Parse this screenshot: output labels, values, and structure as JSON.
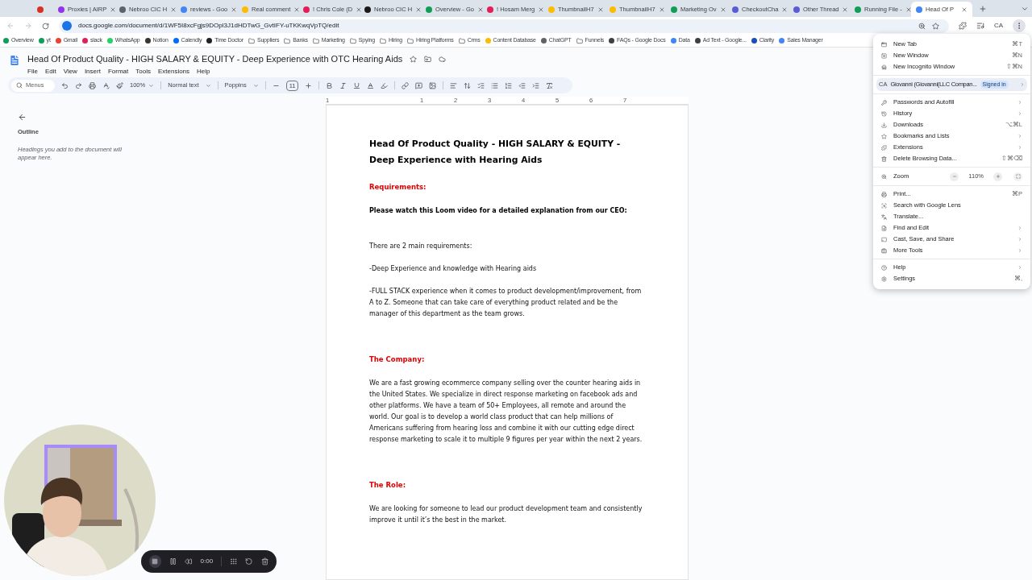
{
  "browser": {
    "tabs": [
      {
        "selected": false,
        "color": "#d93025"
      },
      {
        "title": "Proxies | AIRP",
        "selected": false,
        "color": "#9334e6"
      },
      {
        "title": "Nebroo CIC H",
        "selected": false,
        "color": "#5f6368"
      },
      {
        "title": "reviews - Goo",
        "selected": false,
        "color": "#4285f4"
      },
      {
        "title": "Real comment",
        "selected": false,
        "color": "#fbbc04"
      },
      {
        "title": "! Chris Cole (D",
        "selected": false,
        "color": "#e01e5a"
      },
      {
        "title": "Nebroo CIC H",
        "selected": false,
        "color": "#1a1a1a"
      },
      {
        "title": "Overview - Go",
        "selected": false,
        "color": "#0f9d58"
      },
      {
        "title": "! Hosam Merg",
        "selected": false,
        "color": "#e01e5a"
      },
      {
        "title": "ThumbnailH7",
        "selected": false,
        "color": "#fbbc04"
      },
      {
        "title": "ThumbnailH7",
        "selected": false,
        "color": "#fbbc04"
      },
      {
        "title": "Marketing Ov",
        "selected": false,
        "color": "#0f9d58"
      },
      {
        "title": "CheckoutCha",
        "selected": false,
        "color": "#5b5bd6"
      },
      {
        "title": "Other Thread",
        "selected": false,
        "color": "#5b5bd6"
      },
      {
        "title": "Running File -",
        "selected": false,
        "color": "#0f9d58"
      },
      {
        "title": "Head Of P",
        "selected": true,
        "color": "#4285f4"
      }
    ],
    "address": "docs.google.com/document/d/1WF5I8xcFgjs9DOpl3J1dHDTwG_GvtIFY-uTKKwqVpTQ/edit",
    "profile": "CA",
    "bookmarks": [
      {
        "label": "Overview",
        "kind": "site",
        "color": "#0f9d58"
      },
      {
        "label": "yt",
        "kind": "site",
        "color": "#0f9d58"
      },
      {
        "label": "Gmail",
        "kind": "site",
        "color": "#ea4335"
      },
      {
        "label": "slack",
        "kind": "site",
        "color": "#e01e5a"
      },
      {
        "label": "WhatsApp",
        "kind": "site",
        "color": "#25d366"
      },
      {
        "label": "Notion",
        "kind": "site",
        "color": "#37352f"
      },
      {
        "label": "Calendly",
        "kind": "site",
        "color": "#006bff"
      },
      {
        "label": "Time Doctor",
        "kind": "site",
        "color": "#202124"
      },
      {
        "label": "Suppliers",
        "kind": "folder"
      },
      {
        "label": "Banks",
        "kind": "folder"
      },
      {
        "label": "Marketing",
        "kind": "folder"
      },
      {
        "label": "Spying",
        "kind": "folder"
      },
      {
        "label": "Hiring",
        "kind": "folder"
      },
      {
        "label": "Hiring Platforms",
        "kind": "folder"
      },
      {
        "label": "Crms",
        "kind": "folder"
      },
      {
        "label": "Content Database",
        "kind": "site",
        "color": "#fbbc04"
      },
      {
        "label": "ChatGPT",
        "kind": "site",
        "color": "#5f6368"
      },
      {
        "label": "Funnels",
        "kind": "folder"
      },
      {
        "label": "FAQs - Google Docs",
        "kind": "site",
        "color": "#3c4043"
      },
      {
        "label": "Data",
        "kind": "site",
        "color": "#4285f4"
      },
      {
        "label": "Ad Text - Google...",
        "kind": "site",
        "color": "#3c4043"
      },
      {
        "label": "Clarity",
        "kind": "site",
        "color": "#1a4fb4"
      },
      {
        "label": "Sales Manager",
        "kind": "site",
        "color": "#4285f4"
      }
    ]
  },
  "document": {
    "title": "Head Of Product Quality - HIGH SALARY & EQUITY - Deep Experience with OTC Hearing Aids",
    "menus": [
      "File",
      "Edit",
      "View",
      "Insert",
      "Format",
      "Tools",
      "Extensions",
      "Help"
    ],
    "toolbar": {
      "search_placeholder": "Menus",
      "zoom": "100%",
      "style": "Normal text",
      "font": "Poppins",
      "font_size": "11"
    },
    "ruler": [
      "1",
      "1",
      "2",
      "3",
      "4",
      "5",
      "6",
      "7"
    ],
    "outline": {
      "title": "Outline",
      "hint": "Headings you add to the document will appear here."
    },
    "body": [
      {
        "kind": "title",
        "text": "Head Of Product Quality - HIGH SALARY & EQUITY - Deep Experience with Hearing Aids"
      },
      {
        "kind": "heading",
        "text": "Requirements:"
      },
      {
        "kind": "bold",
        "text": "Please watch this Loom video for a detailed explanation from our CEO:"
      },
      {
        "kind": "para",
        "text": "There are 2 main requirements:"
      },
      {
        "kind": "para",
        "text": "-Deep Experience and knowledge with Hearing aids"
      },
      {
        "kind": "para",
        "text": "-FULL STACK experience when it comes to product development/improvement, from A to Z. Someone that can take care of everything product related and be the manager of this department as the team grows."
      },
      {
        "kind": "heading",
        "text": "The Company:"
      },
      {
        "kind": "para",
        "text": "We are a fast growing ecommerce company selling over the counter hearing aids in the United States. We specialize in direct response marketing on facebook ads and other platforms. We have a team of 50+ Employees, all remote and around the world. Our goal is to develop a world class product that can help millions of Americans suffering from hearing loss and combine it with our cutting edge direct response marketing to scale it to multiple 9 figures per year within the next 2 years."
      },
      {
        "kind": "heading",
        "text": "The Role:"
      },
      {
        "kind": "para",
        "text": "We are looking for someone to lead our product development team and consistently improve it until it’s the best in the market."
      }
    ]
  },
  "chrome_menu": {
    "sections": [
      [
        {
          "kind": "item",
          "label": "New Tab",
          "shortcut": "⌘T"
        },
        {
          "kind": "item",
          "label": "New Window",
          "shortcut": "⌘N"
        },
        {
          "kind": "item",
          "label": "New Incognito Window",
          "shortcut": "⇧⌘N"
        }
      ],
      [
        {
          "kind": "profile",
          "avatar": "CA",
          "label": "Giovanni (Giovanni(LLC Compan...",
          "badge": "Signed in",
          "submenu": true
        }
      ],
      [
        {
          "kind": "item",
          "label": "Passwords and Autofill",
          "submenu": true
        },
        {
          "kind": "item",
          "label": "History",
          "submenu": true
        },
        {
          "kind": "item",
          "label": "Downloads",
          "shortcut": "⌥⌘L"
        },
        {
          "kind": "item",
          "label": "Bookmarks and Lists",
          "submenu": true
        },
        {
          "kind": "item",
          "label": "Extensions",
          "submenu": true
        },
        {
          "kind": "item",
          "label": "Delete Browsing Data...",
          "shortcut": "⇧⌘⌫"
        }
      ],
      [
        {
          "kind": "zoom",
          "label": "Zoom",
          "value": "110%"
        }
      ],
      [
        {
          "kind": "item",
          "label": "Print...",
          "shortcut": "⌘P"
        },
        {
          "kind": "item",
          "label": "Search with Google Lens"
        },
        {
          "kind": "item",
          "label": "Translate..."
        },
        {
          "kind": "item",
          "label": "Find and Edit",
          "submenu": true
        },
        {
          "kind": "item",
          "label": "Cast, Save, and Share",
          "submenu": true
        },
        {
          "kind": "item",
          "label": "More Tools",
          "submenu": true
        }
      ],
      [
        {
          "kind": "item",
          "label": "Help",
          "submenu": true
        },
        {
          "kind": "item",
          "label": "Settings",
          "shortcut": "⌘,"
        }
      ]
    ]
  },
  "recorder": {
    "time": "0:00"
  }
}
